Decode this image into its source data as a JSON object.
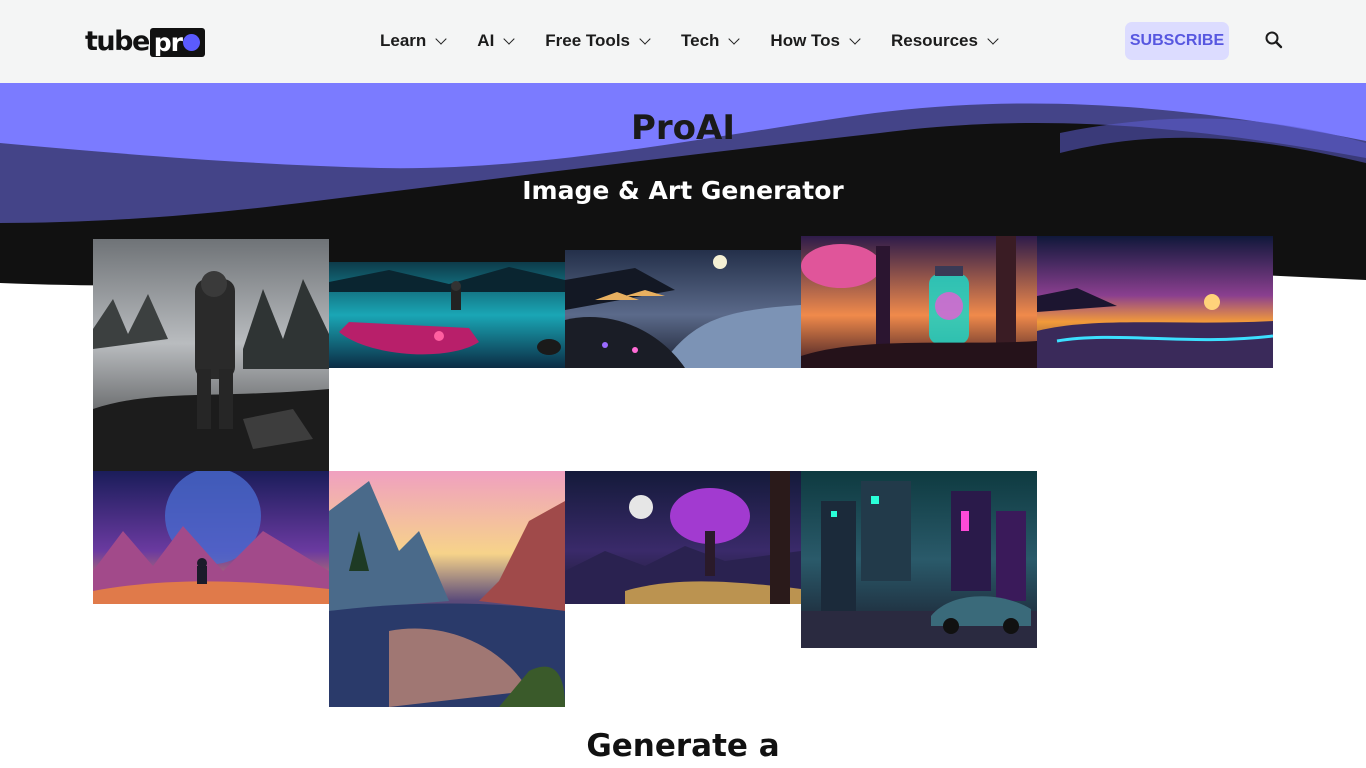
{
  "header": {
    "logo": {
      "text_left": "tube",
      "text_right": "pr"
    },
    "nav": [
      {
        "label": "Learn"
      },
      {
        "label": "AI"
      },
      {
        "label": "Free Tools"
      },
      {
        "label": "Tech"
      },
      {
        "label": "How Tos"
      },
      {
        "label": "Resources"
      }
    ],
    "subscribe_label": "SUBSCRIBE",
    "search_icon": "search-icon"
  },
  "hero": {
    "title": "ProAI",
    "subtitle": "Image & Art Generator"
  },
  "gallery": {
    "images": [
      {
        "name": "astronaut-on-rocky-shore-image"
      },
      {
        "name": "boat-on-neon-lake-image"
      },
      {
        "name": "night-beach-umbrellas-image"
      },
      {
        "name": "glowing-jar-in-forest-image"
      },
      {
        "name": "colorful-sunset-beach-image"
      },
      {
        "name": "child-under-big-moon-image"
      },
      {
        "name": "mountain-lake-sunset-image"
      },
      {
        "name": "purple-tree-moonlit-image"
      },
      {
        "name": "cyberpunk-city-car-image"
      }
    ]
  },
  "section": {
    "heading": "Generate a"
  },
  "colors": {
    "accent": "#7b7bff",
    "subscribe_bg": "#dcdcff",
    "subscribe_text": "#5757e0",
    "hero_dark": "#111111"
  }
}
